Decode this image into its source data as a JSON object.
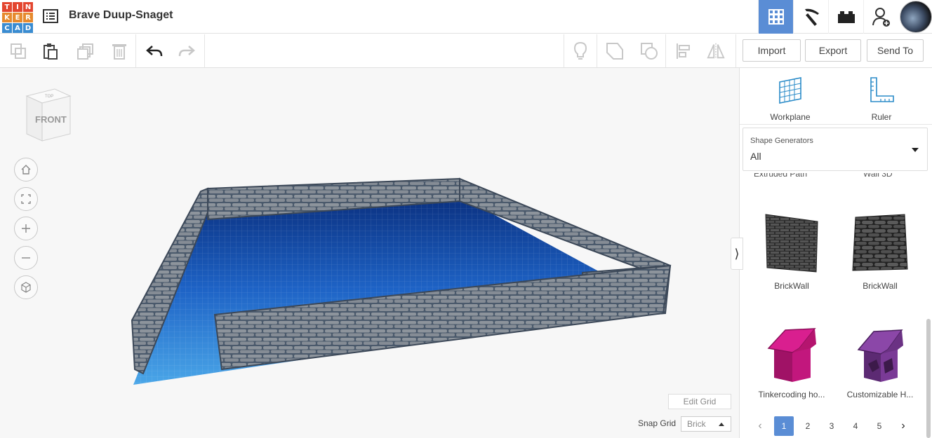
{
  "logo": {
    "letters": [
      "T",
      "I",
      "N",
      "K",
      "E",
      "R",
      "C",
      "A",
      "D"
    ],
    "colors": [
      "#e3462f",
      "#e3462f",
      "#e3462f",
      "#e68a2e",
      "#e68a2e",
      "#e68a2e",
      "#3a8cd1",
      "#3a8cd1",
      "#3a8cd1"
    ]
  },
  "header": {
    "design_title": "Brave Duup-Snaget",
    "list_icon": "list-icon"
  },
  "topright": {
    "grid_icon": "3d-design-grid-icon",
    "pickaxe_icon": "pickaxe-icon",
    "brick_icon": "brick-icon",
    "user_add_icon": "user-add-icon",
    "accent": "#5a8dd5"
  },
  "toolbar": {
    "import_label": "Import",
    "export_label": "Export",
    "send_to_label": "Send To"
  },
  "viewcube": {
    "face_label": "FRONT",
    "top_label": "TOP"
  },
  "viewport": {
    "edit_grid_label": "Edit Grid",
    "snap_grid_label": "Snap Grid",
    "snap_grid_value": "Brick"
  },
  "panel": {
    "workplane_label": "Workplane",
    "ruler_label": "Ruler",
    "generators_caption": "Shape Generators",
    "generators_value": "All",
    "cut_labels": [
      "Extruded Path",
      "Wall 3D"
    ],
    "shapes": [
      {
        "name": "BrickWall",
        "color": "#4a4a4a"
      },
      {
        "name": "BrickWall",
        "color": "#555555"
      },
      {
        "name": "Tinkercoding ho...",
        "color": "#c2177d"
      },
      {
        "name": "Customizable H...",
        "color": "#7a3a96"
      }
    ],
    "pages": [
      "1",
      "2",
      "3",
      "4",
      "5"
    ],
    "active_page": "1"
  }
}
